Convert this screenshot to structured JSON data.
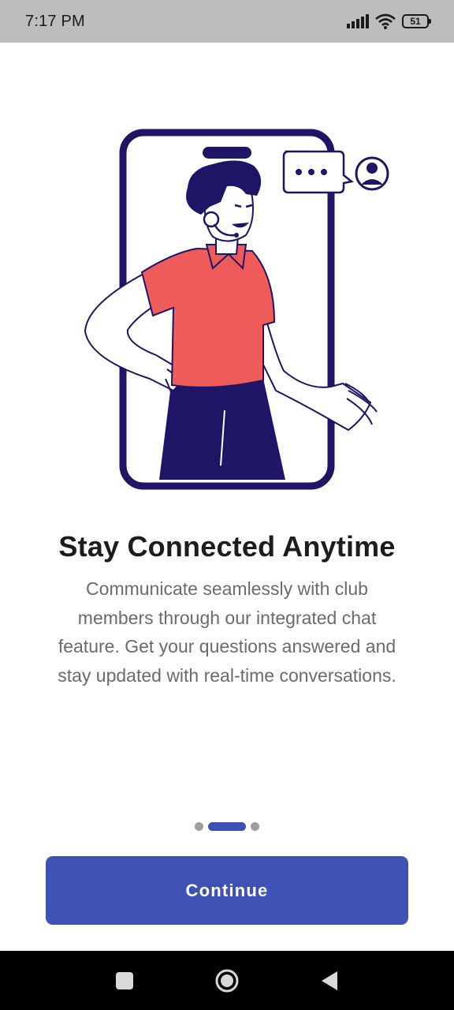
{
  "status_bar": {
    "time": "7:17 PM",
    "battery_level": "51",
    "icons": [
      "signal-icon",
      "wifi-icon",
      "battery-icon"
    ]
  },
  "onboarding": {
    "illustration": "person-with-headset-in-phone-chatting",
    "title": "Stay Connected Anytime",
    "description": "Communicate seamlessly with club members through our integrated chat feature. Get your questions answered and stay updated with real-time conversations.",
    "page_indicator": {
      "total": 3,
      "current": 2
    },
    "continue_label": "Continue"
  },
  "colors": {
    "primary": "#3f51b5",
    "illustration_navy": "#1e1566",
    "illustration_coral": "#ef5b5b",
    "title": "#1c1c1c",
    "description": "#6b6b6b"
  },
  "nav_bar": {
    "icons": [
      "recents-icon",
      "home-icon",
      "back-icon"
    ]
  }
}
